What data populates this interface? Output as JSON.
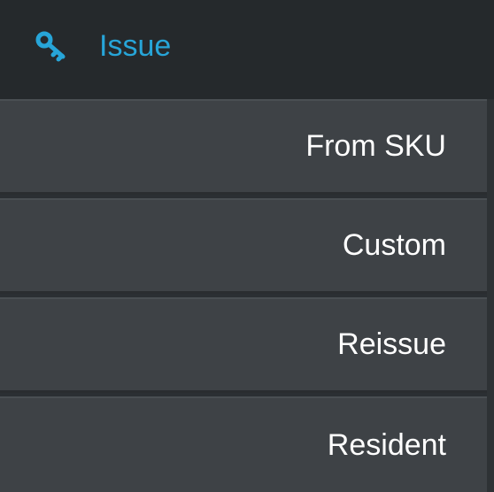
{
  "menu": {
    "header": {
      "icon": "key-icon",
      "label": "Issue",
      "color": "#27a5d8"
    },
    "items": [
      {
        "label": "From SKU"
      },
      {
        "label": "Custom"
      },
      {
        "label": "Reissue"
      },
      {
        "label": "Resident"
      }
    ]
  }
}
